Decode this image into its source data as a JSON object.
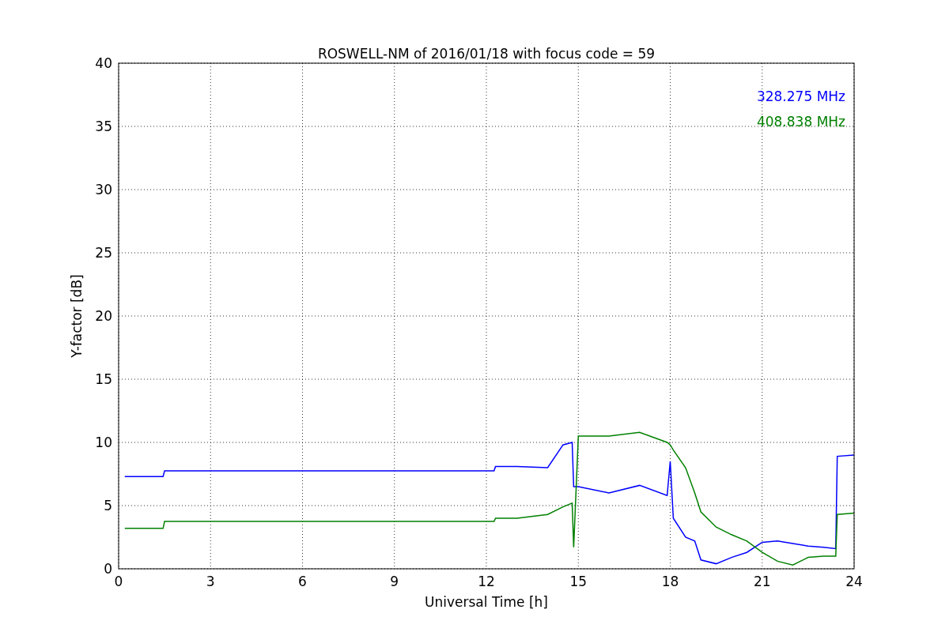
{
  "figure": {
    "chart_data": {
      "type": "line",
      "title": "ROSWELL-NM of 2016/01/18 with focus code = 59",
      "xlabel": "Universal Time [h]",
      "ylabel": "Y-factor [dB]",
      "x": [
        0.2,
        1.45,
        1.5,
        12.25,
        12.3,
        13,
        14,
        14.5,
        14.8,
        14.85,
        15,
        16,
        17,
        17.9,
        18,
        18.1,
        18.5,
        18.8,
        19,
        19.5,
        20,
        20.5,
        21,
        21.5,
        22,
        22.5,
        23,
        23.4,
        23.45,
        24
      ],
      "series": [
        {
          "name": "328.275 MHz",
          "color": "#0000ff",
          "values": [
            7.3,
            7.3,
            7.75,
            7.75,
            8.1,
            8.1,
            8.0,
            9.8,
            10.0,
            6.5,
            6.5,
            6.0,
            6.6,
            5.8,
            8.5,
            4.0,
            2.5,
            2.2,
            0.7,
            0.4,
            0.9,
            1.3,
            2.1,
            2.2,
            2.0,
            1.8,
            1.7,
            1.6,
            8.9,
            9.0
          ]
        },
        {
          "name": "408.838 MHz",
          "color": "#008000",
          "values": [
            3.2,
            3.2,
            3.75,
            3.75,
            4.0,
            4.0,
            4.3,
            4.9,
            5.2,
            1.7,
            10.5,
            10.5,
            10.8,
            10.0,
            9.8,
            9.4,
            8.0,
            6.0,
            4.5,
            3.3,
            2.7,
            2.2,
            1.3,
            0.6,
            0.3,
            0.9,
            1.0,
            1.0,
            4.3,
            4.4
          ]
        }
      ],
      "xlim": [
        0,
        24
      ],
      "ylim": [
        0,
        40
      ],
      "xticks": [
        0,
        3,
        6,
        9,
        12,
        15,
        18,
        21,
        24
      ],
      "yticks": [
        0,
        5,
        10,
        15,
        20,
        25,
        30,
        35,
        40
      ],
      "grid": true
    }
  }
}
